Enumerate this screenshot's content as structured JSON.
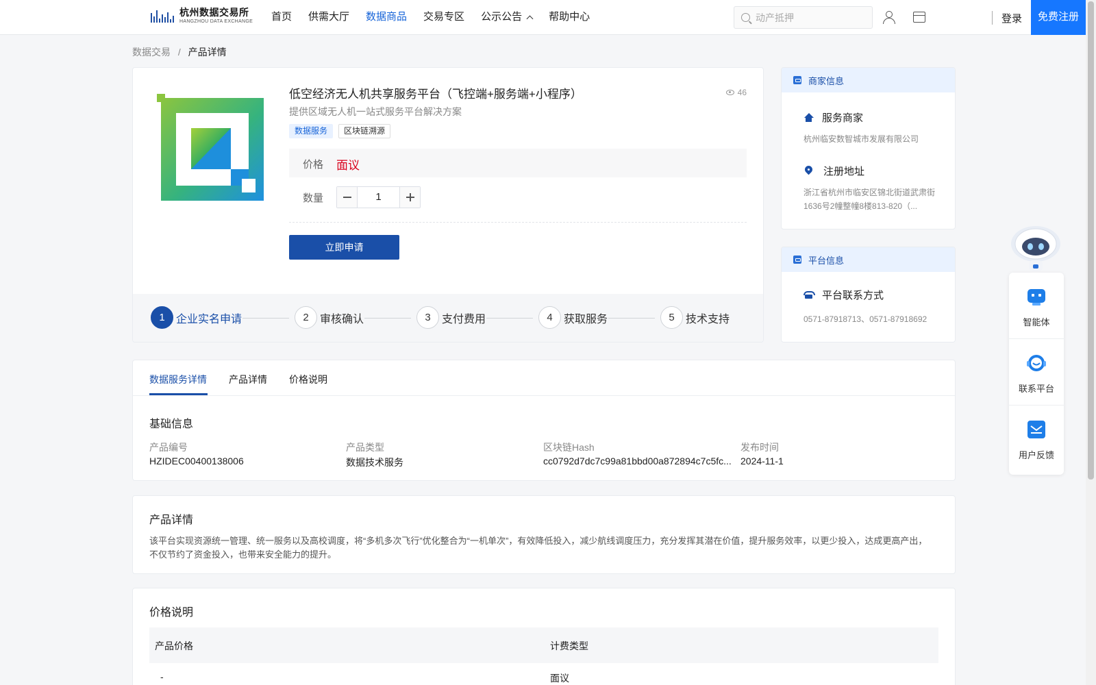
{
  "header": {
    "logo_cn": "杭州数据交易所",
    "logo_en": "HANGZHOU DATA EXCHANGE",
    "nav": [
      {
        "label": "首页",
        "active": false
      },
      {
        "label": "供需大厅",
        "active": false
      },
      {
        "label": "数据商品",
        "active": true
      },
      {
        "label": "交易专区",
        "active": false
      },
      {
        "label": "公示公告",
        "active": false,
        "has_dropdown": true
      },
      {
        "label": "帮助中心",
        "active": false
      }
    ],
    "search_placeholder": "动产抵押",
    "login_label": "登录",
    "register_label": "免费注册"
  },
  "breadcrumb": {
    "root": "数据交易",
    "sep": "/",
    "current": "产品详情"
  },
  "product": {
    "title": "低空经济无人机共享服务平台（飞控端+服务端+小程序）",
    "views": "46",
    "subtitle": "提供区域无人机一站式服务平台解决方案",
    "tags": [
      "数据服务",
      "区块链溯源"
    ],
    "price_label": "价格",
    "price_value": "面议",
    "qty_label": "数量",
    "qty_value": "1",
    "apply_label": "立即申请"
  },
  "steps": [
    {
      "num": "1",
      "label": "企业实名申请",
      "active": true
    },
    {
      "num": "2",
      "label": "审核确认",
      "active": false
    },
    {
      "num": "3",
      "label": "支付费用",
      "active": false
    },
    {
      "num": "4",
      "label": "获取服务",
      "active": false
    },
    {
      "num": "5",
      "label": "技术支持",
      "active": false
    }
  ],
  "merchant": {
    "header": "商家信息",
    "service_title": "服务商家",
    "service_value": "杭州临安数智城市发展有限公司",
    "address_title": "注册地址",
    "address_value": "浙江省杭州市临安区锦北街道武肃街1636号2幢整幢8楼813-820（..."
  },
  "platform": {
    "header": "平台信息",
    "contact_title": "平台联系方式",
    "contact_value": "0571-87918713、0571-87918692"
  },
  "float_panel": {
    "items": [
      {
        "label": "智能体",
        "icon": "agent-icon"
      },
      {
        "label": "联系平台",
        "icon": "headset-icon"
      },
      {
        "label": "用户反馈",
        "icon": "mail-icon"
      }
    ]
  },
  "detail_tabs": [
    "数据服务详情",
    "产品详情",
    "价格说明"
  ],
  "basic_info": {
    "title": "基础信息",
    "fields": [
      {
        "label": "产品编号",
        "value": "HZIDEC00400138006"
      },
      {
        "label": "产品类型",
        "value": "数据技术服务"
      },
      {
        "label": "区块链Hash",
        "value": "cc0792d7dc7c99a81bbd00a872894c7c5fc..."
      },
      {
        "label": "发布时间",
        "value": "2024-11-1"
      }
    ]
  },
  "description": {
    "title": "产品详情",
    "text": "该平台实现资源统一管理、统一服务以及高校调度，将“多机多次飞行”优化整合为“一机单次”，有效降低投入，减少航线调度压力，充分发挥其潜在价值，提升服务效率，以更少投入，达成更高产出，不仅节约了资金投入，也带来安全能力的提升。"
  },
  "pricing": {
    "title": "价格说明",
    "columns": [
      "产品价格",
      "计费类型"
    ],
    "rows": [
      [
        "-",
        "面议"
      ]
    ]
  },
  "colors": {
    "primary": "#1a4fa8",
    "accent": "#1677ff",
    "price": "#d9001b"
  }
}
